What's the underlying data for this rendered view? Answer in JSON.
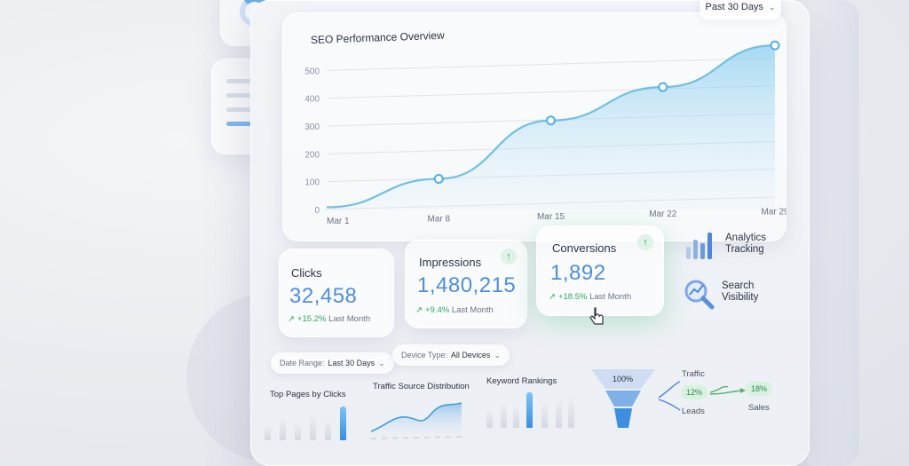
{
  "range_selector": {
    "label": "Past 30 Days"
  },
  "chart_card": {
    "title": "SEO Performance Overview"
  },
  "chart_data": {
    "type": "area",
    "title": "SEO Performance Overview",
    "x": [
      "Mar 1",
      "Mar 8",
      "Mar 15",
      "Mar 22",
      "Mar 29"
    ],
    "y_ticks": [
      "0",
      "100",
      "200",
      "300",
      "400",
      "500"
    ],
    "ylim": [
      0,
      600
    ],
    "values": [
      8,
      110,
      320,
      440,
      590
    ],
    "markers": [
      false,
      true,
      true,
      true,
      true
    ],
    "grid": true
  },
  "metrics": [
    {
      "label": "Clicks",
      "value": "32,458",
      "delta": "+15.2%",
      "delta_suffix": "Last Month"
    },
    {
      "label": "Impressions",
      "value": "1,480,215",
      "delta": "+9.4%",
      "delta_suffix": "Last Month"
    },
    {
      "label": "Conversions",
      "value": "1,892",
      "delta": "+18.5%",
      "delta_suffix": "Last Month"
    }
  ],
  "side_items": [
    {
      "line1": "Analytics",
      "line2": "Tracking"
    },
    {
      "line1": "Search",
      "line2": "Visibility"
    }
  ],
  "filters": {
    "date_range": {
      "label": "Date Range:",
      "value": "Last 30 Days"
    },
    "device_type": {
      "label": "Device Type:",
      "value": "All Devices"
    }
  },
  "mini_widgets": {
    "top_pages": "Top Pages by Clicks",
    "traffic_source": "Traffic Source Distribution",
    "keyword_rankings": "Keyword Rankings"
  },
  "funnel": {
    "top": "100%",
    "traffic": "Traffic",
    "leads_pct": "12%",
    "leads": "Leads",
    "sales_pct": "18%",
    "sales": "Sales"
  },
  "colors": {
    "accent": "#4d8fdc",
    "positive": "#2bab5b",
    "line": "#6ec1e4"
  }
}
